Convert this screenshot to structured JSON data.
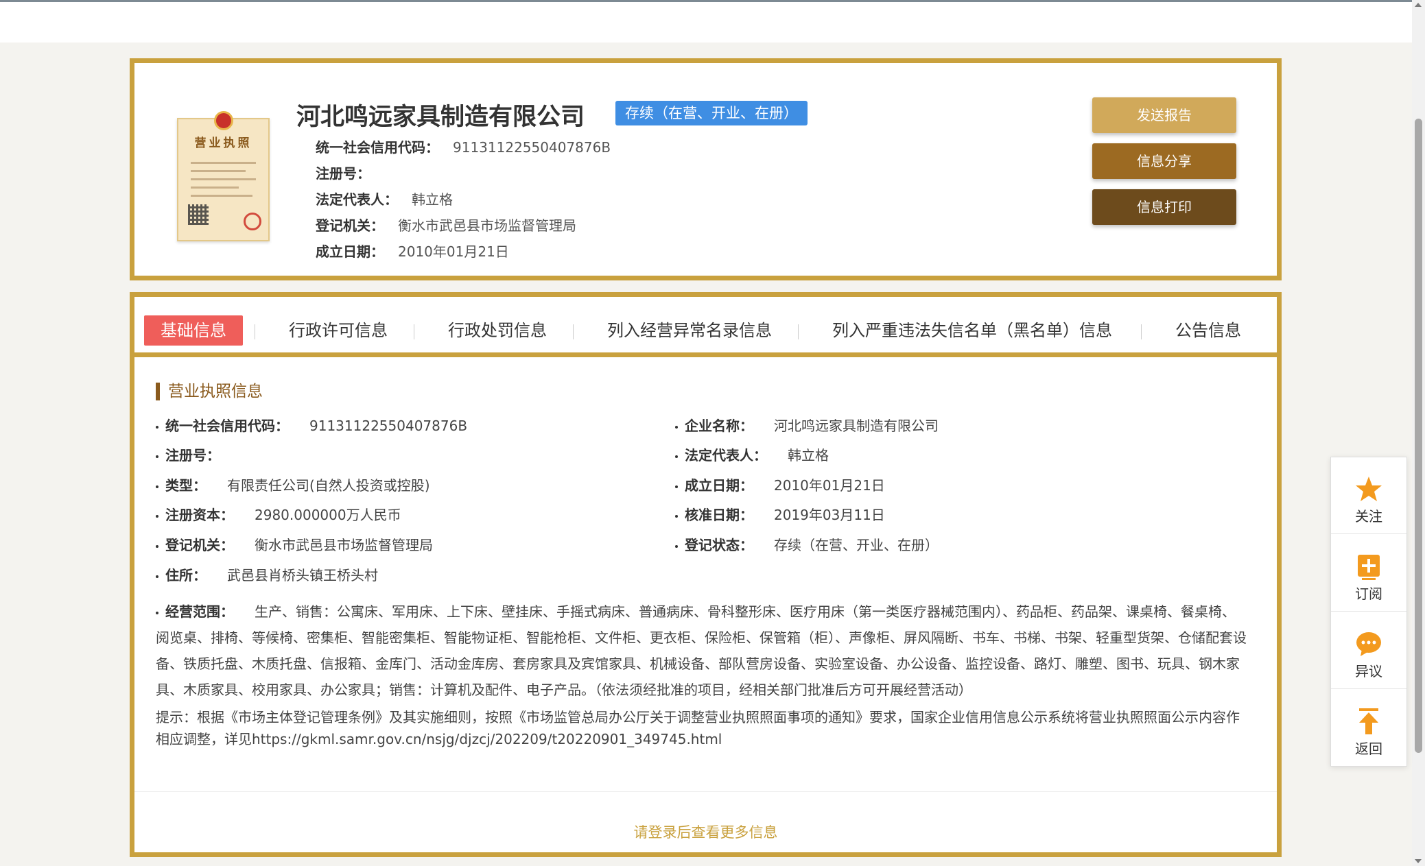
{
  "company": {
    "name": "河北鸣远家具制造有限公司",
    "status": "存续（在营、开业、在册）"
  },
  "license_image": {
    "title": "营业执照"
  },
  "header_info": [
    {
      "label": "统一社会信用代码：",
      "value": "91131122550407876B"
    },
    {
      "label": "注册号：",
      "value": ""
    },
    {
      "label": "法定代表人：",
      "value": "韩立格"
    },
    {
      "label": "登记机关：",
      "value": "衡水市武邑县市场监督管理局"
    },
    {
      "label": "成立日期：",
      "value": "2010年01月21日"
    }
  ],
  "actions": {
    "report": "发送报告",
    "share": "信息分享",
    "print": "信息打印"
  },
  "tabs": [
    {
      "label": "基础信息"
    },
    {
      "label": "行政许可信息"
    },
    {
      "label": "行政处罚信息"
    },
    {
      "label": "列入经营异常名录信息"
    },
    {
      "label": "列入严重违法失信名单（黑名单）信息"
    },
    {
      "label": "公告信息"
    }
  ],
  "section": {
    "title": "营业执照信息"
  },
  "fields": {
    "credit_code": {
      "label": "统一社会信用代码：",
      "value": "91131122550407876B"
    },
    "company_name": {
      "label": "企业名称：",
      "value": "河北鸣远家具制造有限公司"
    },
    "reg_no": {
      "label": "注册号：",
      "value": ""
    },
    "legal_rep": {
      "label": "法定代表人：",
      "value": "韩立格"
    },
    "type": {
      "label": "类型：",
      "value": "有限责任公司(自然人投资或控股)"
    },
    "founded": {
      "label": "成立日期：",
      "value": "2010年01月21日"
    },
    "capital": {
      "label": "注册资本：",
      "value": "2980.000000万人民币"
    },
    "approved": {
      "label": "核准日期：",
      "value": "2019年03月11日"
    },
    "authority": {
      "label": "登记机关：",
      "value": "衡水市武邑县市场监督管理局"
    },
    "reg_status": {
      "label": "登记状态：",
      "value": "存续（在营、开业、在册）"
    },
    "address": {
      "label": "住所：",
      "value": "武邑县肖桥头镇王桥头村"
    }
  },
  "scope": {
    "label": "经营范围：",
    "value": "生产、销售：公寓床、军用床、上下床、壁挂床、手摇式病床、普通病床、骨科整形床、医疗用床（第一类医疗器械范围内）、药品柜、药品架、课桌椅、餐桌椅、阅览桌、排椅、等候椅、密集柜、智能密集柜、智能物证柜、智能枪柜、文件柜、更衣柜、保险柜、保管箱（柜）、声像柜、屏风隔断、书车、书梯、书架、轻重型货架、仓储配套设备、铁质托盘、木质托盘、信报箱、金库门、活动金库房、套房家具及宾馆家具、机械设备、部队营房设备、实验室设备、办公设备、监控设备、路灯、雕塑、图书、玩具、钢木家具、木质家具、校用家具、办公家具；销售：计算机及配件、电子产品。（依法须经批准的项目，经相关部门批准后方可开展经营活动）"
  },
  "hint": "提示：根据《市场主体登记管理条例》及其实施细则，按照《市场监管总局办公厅关于调整营业执照照面事项的通知》要求，国家企业信用信息公示系统将营业执照照面公示内容作相应调整，详见https://gkml.samr.gov.cn/nsjg/djzcj/202209/t20220901_349745.html",
  "login_prompt": "请登录后查看更多信息",
  "side_toolbar": [
    {
      "label": "关注",
      "icon": "star-icon"
    },
    {
      "label": "订阅",
      "icon": "plus-box-icon"
    },
    {
      "label": "异议",
      "icon": "chat-bubble-icon"
    },
    {
      "label": "返回",
      "icon": "arrow-up-icon"
    }
  ],
  "colors": {
    "gold_border": "#c9a13e",
    "status_blue": "#3f8ee3",
    "tab_active": "#ef5e5a",
    "btn_report": "#d1a95a",
    "btn_share": "#9c6a22",
    "btn_print": "#6d4b1c",
    "icon_orange": "#f39a1e"
  }
}
